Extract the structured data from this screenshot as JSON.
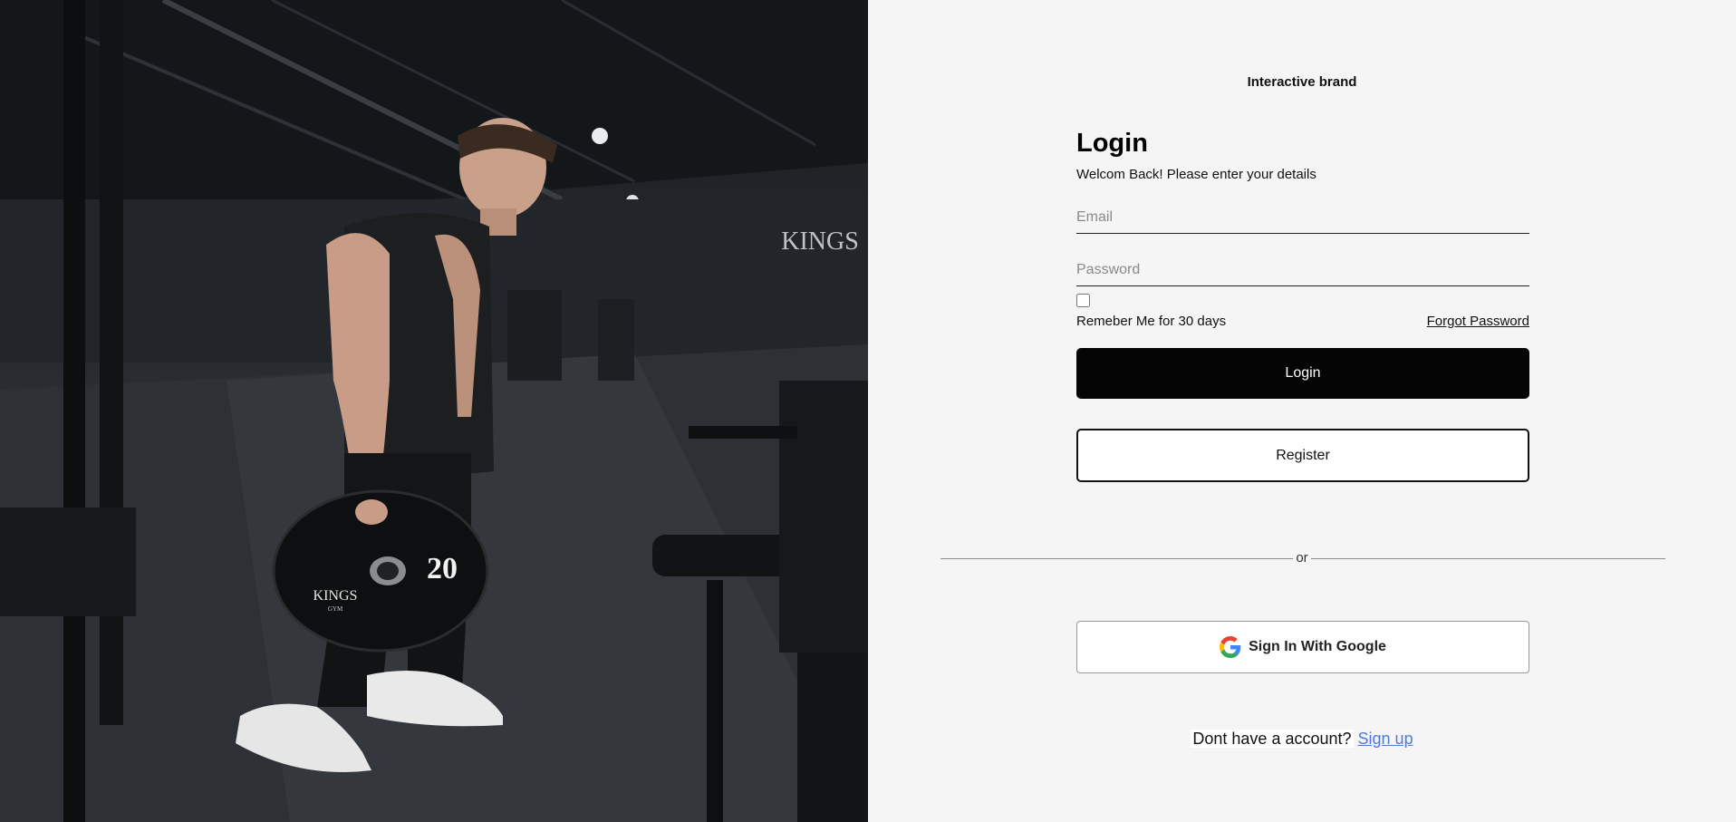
{
  "brand": {
    "name": "Interactive brand"
  },
  "hero": {
    "plate_weight": "20",
    "logo_text": "KINGS",
    "logo_subtext": "GYM",
    "wall_logo_text": "KINGS"
  },
  "login": {
    "title": "Login",
    "subtitle": "Welcom Back! Please enter your details",
    "email_placeholder": "Email",
    "password_placeholder": "Password",
    "remember_label": "Remeber Me for 30 days",
    "forgot_label": "Forgot Password",
    "login_button": "Login",
    "register_button": "Register"
  },
  "divider": {
    "text": "or"
  },
  "google": {
    "label": "Sign In With Google"
  },
  "signup": {
    "prompt": "Dont have a account?",
    "link": "Sign up"
  },
  "colors": {
    "primary_button": "#050505",
    "panel_background": "#f5f5f5",
    "link": "#4a7ed9"
  }
}
